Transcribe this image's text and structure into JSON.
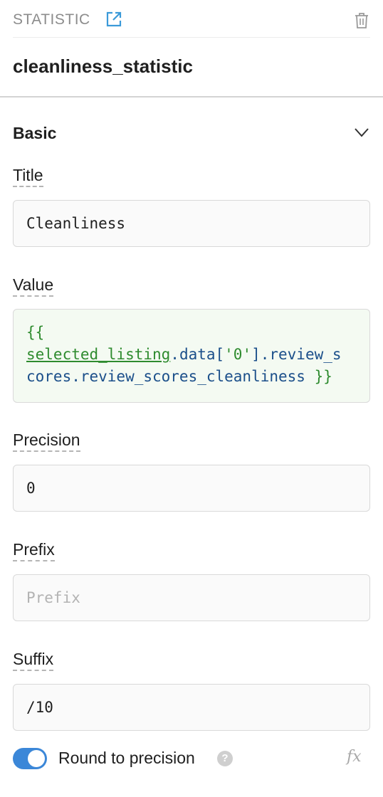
{
  "header": {
    "type_label": "STATISTIC",
    "edit_icon": "external-edit-icon",
    "delete_icon": "trash-icon"
  },
  "component": {
    "name": "cleanliness_statistic"
  },
  "section": {
    "title": "Basic",
    "expanded": true,
    "chevron_icon": "chevron-down-icon"
  },
  "fields": {
    "title": {
      "label": "Title",
      "value": "Cleanliness"
    },
    "value": {
      "label": "Value",
      "code": {
        "line1_open": "{{",
        "line2_ident": "selected_listing",
        "line2_dot": ".data[",
        "line2_str": "'0'",
        "line2_rest": "].review_s",
        "line3_rest": "cores.review_scores_cleanliness ",
        "line3_close": "}}"
      }
    },
    "precision": {
      "label": "Precision",
      "value": "0"
    },
    "prefix": {
      "label": "Prefix",
      "value": "",
      "placeholder": "Prefix"
    },
    "suffix": {
      "label": "Suffix",
      "value": "/10"
    }
  },
  "round_toggle": {
    "label": "Round to precision",
    "on": true,
    "help_glyph": "?",
    "fx_label": "fx"
  },
  "colors": {
    "accent": "#3b87d8",
    "code_green": "#2e8b2e",
    "code_blue": "#1b4f8a"
  }
}
